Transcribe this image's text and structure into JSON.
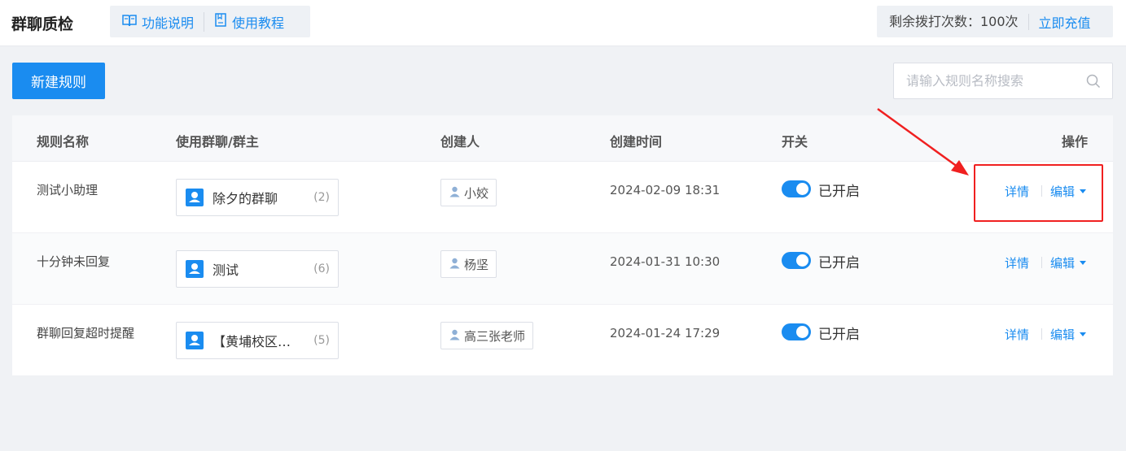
{
  "header": {
    "title": "群聊质检",
    "help_links": [
      {
        "label": "功能说明",
        "icon": "book-icon"
      },
      {
        "label": "使用教程",
        "icon": "document-icon"
      }
    ],
    "credits_text": "剩余拨打次数：100次",
    "recharge_label": "立即充值"
  },
  "toolbar": {
    "new_rule_label": "新建规则",
    "search_placeholder": "请输入规则名称搜索"
  },
  "table": {
    "columns": [
      "规则名称",
      "使用群聊/群主",
      "创建人",
      "创建时间",
      "开关",
      "操作"
    ],
    "rows": [
      {
        "name": "测试小助理",
        "group": "除夕的群聊",
        "group_count": "(2)",
        "creator": "小姣",
        "created_at": "2024-02-09 18:31",
        "switch_label": "已开启",
        "switch_on": true,
        "detail_label": "详情",
        "edit_label": "编辑"
      },
      {
        "name": "十分钟未回复",
        "group": "测试",
        "group_count": "(6)",
        "creator": "杨坚",
        "created_at": "2024-01-31 10:30",
        "switch_label": "已开启",
        "switch_on": true,
        "detail_label": "详情",
        "edit_label": "编辑"
      },
      {
        "name": "群聊回复超时提醒",
        "group": "【黄埔校区】...",
        "group_count": "(5)",
        "creator": "高三张老师",
        "created_at": "2024-01-24 17:29",
        "switch_label": "已开启",
        "switch_on": true,
        "detail_label": "详情",
        "edit_label": "编辑"
      }
    ]
  },
  "colors": {
    "primary": "#1a8cf0",
    "annotation": "#f02020"
  }
}
